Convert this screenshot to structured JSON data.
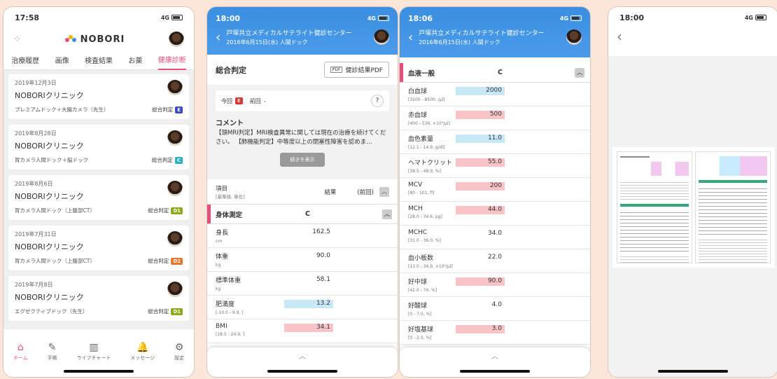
{
  "screen1": {
    "time": "17:58",
    "network": "4G",
    "logo": "NOBORI",
    "tabs": [
      "治療履歴",
      "画像",
      "検査結果",
      "お薬",
      "健康診断"
    ],
    "cards": [
      {
        "date": "2019年12月3日",
        "clinic": "NOBORIクリニック",
        "course": "プレミアムドック＋大腸カメラ（先生）",
        "judge": "総合判定",
        "grade": "E",
        "color": "#3b4bc8"
      },
      {
        "date": "2019年8月28日",
        "clinic": "NOBORIクリニック",
        "course": "胃カメラ人間ドック＋脳ドック",
        "judge": "総合判定",
        "grade": "C",
        "color": "#2bb0c0"
      },
      {
        "date": "2019年8月6日",
        "clinic": "NOBORIクリニック",
        "course": "胃カメラ人間ドック（上腹部CT）",
        "judge": "総合判定",
        "grade": "D1",
        "color": "#8aaa1c"
      },
      {
        "date": "2019年7月31日",
        "clinic": "NOBORIクリニック",
        "course": "胃カメラ人間ドック（上腹部CT）",
        "judge": "総合判定",
        "grade": "D2",
        "color": "#e8762a"
      },
      {
        "date": "2019年7月8日",
        "clinic": "NOBORIクリニック",
        "course": "エグゼクティブドック（先生）",
        "judge": "総合判定",
        "grade": "D1",
        "color": "#8aaa1c"
      }
    ],
    "nav": [
      {
        "icon": "⌂",
        "label": "ホーム",
        "name": "home"
      },
      {
        "icon": "✎",
        "label": "手帳",
        "name": "notebook"
      },
      {
        "icon": "▥",
        "label": "ライフチャート",
        "name": "lifechart"
      },
      {
        "icon": "🔔",
        "label": "メッセージ",
        "name": "message"
      },
      {
        "icon": "⚙",
        "label": "設定",
        "name": "settings"
      }
    ]
  },
  "screen2": {
    "time": "18:00",
    "network": "4G",
    "header_title": "戸塚共立メディカルサテライト健診センター",
    "header_sub": "2016年6月15日(水) 人間ドック",
    "sogo": "総合判定",
    "pdf_label": "健診結果PDF",
    "pdf_icon": "PDF",
    "konkai": "今回",
    "konkai_grade": "E",
    "zenkai": "前回",
    "zenkai_val": "-",
    "help": "?",
    "comment_title": "コメント",
    "comment_body": "【頭MRI判定】MRI検査異常に関しては現在の治療を続けてください。 【肺機能判定】中等度以上の閉塞性障害を認めま…",
    "more_label": "続きを表示",
    "col_item": "項目",
    "col_item_sub": "[基準値, 単位]",
    "col_result": "結果",
    "col_prev": "(前回)",
    "category": "身体測定",
    "category_grade": "C",
    "items": [
      {
        "name": "身長",
        "ref": "cm",
        "value": "162.5",
        "flag": ""
      },
      {
        "name": "体重",
        "ref": "kg",
        "value": "90.0",
        "flag": ""
      },
      {
        "name": "標準体重",
        "ref": "kg",
        "value": "58.1",
        "flag": ""
      },
      {
        "name": "肥満度",
        "ref": "[-10.0 - 9.9, ]",
        "value": "13.2",
        "flag": "lo"
      },
      {
        "name": "BMI",
        "ref": "[18.5 - 24.9, ]",
        "value": "34.1",
        "flag": "hi"
      }
    ],
    "sheet_chevron": "︿"
  },
  "screen3": {
    "time": "18:06",
    "network": "4G",
    "header_title": "戸塚共立メディカルサテライト健診センター",
    "header_sub": "2016年6月15日(水) 人間ドック",
    "category": "血液一般",
    "category_grade": "C",
    "items": [
      {
        "name": "白血球",
        "ref": "[3200 - 8500, /μl]",
        "value": "2000",
        "flag": "lo"
      },
      {
        "name": "赤血球",
        "ref": "[400 - 539, ×10⁴/μl]",
        "value": "500",
        "flag": "hi"
      },
      {
        "name": "血色素量",
        "ref": "[12.1 - 14.9, g/dl]",
        "value": "11.0",
        "flag": "lo"
      },
      {
        "name": "ヘマトクリット",
        "ref": "[38.5 - 48.9, %]",
        "value": "55.0",
        "flag": "hi"
      },
      {
        "name": "MCV",
        "ref": "[80 - 101, fl]",
        "value": "200",
        "flag": "hi"
      },
      {
        "name": "MCH",
        "ref": "[28.0 - 34.6, pg]",
        "value": "44.0",
        "flag": "hi"
      },
      {
        "name": "MCHC",
        "ref": "[31.0 - 36.0, %]",
        "value": "34.0",
        "flag": ""
      },
      {
        "name": "血小板数",
        "ref": "[13.0 - 34.9, ×10⁴/μl]",
        "value": "22.0",
        "flag": ""
      },
      {
        "name": "好中球",
        "ref": "[42.0 - 74, %]",
        "value": "90.0",
        "flag": "hi"
      },
      {
        "name": "好酸球",
        "ref": "[0 - 7.0, %]",
        "value": "4.0",
        "flag": ""
      },
      {
        "name": "好塩基球",
        "ref": "[0 - 2.0, %]",
        "value": "3.0",
        "flag": "hi"
      }
    ],
    "sheet_chevron": "︿"
  },
  "screen4": {
    "time": "18:00",
    "network": "4G"
  }
}
